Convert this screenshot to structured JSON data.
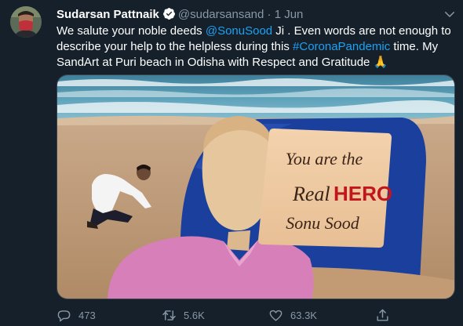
{
  "tweet": {
    "author_name": "Sudarsan Pattnaik",
    "handle": "@sudarsansand",
    "separator": "·",
    "date": "1 Jun",
    "text": {
      "part1": "We salute your noble deeds ",
      "mention": "@SonuSood",
      "part2": " Ji . Even words are not enough to describe your help to the helpless during this ",
      "hashtag": "#CoronaPandemic",
      "part3": " time. My SandArt at Puri beach in Odisha with Respect and Gratitude 🙏"
    },
    "media": {
      "sign_line1": "You are the",
      "sign_line2a": "Real",
      "sign_line2b": "HERO",
      "sign_line3": "Sonu Sood"
    },
    "stats": {
      "replies": "473",
      "retweets": "5.6K",
      "likes": "63.3K"
    }
  },
  "icons": {
    "verified": "verified-badge-icon",
    "more": "chevron-down-icon",
    "reply": "reply-icon",
    "retweet": "retweet-icon",
    "like": "heart-icon",
    "share": "share-icon"
  },
  "colors": {
    "background": "#15202b",
    "link": "#1da1f2",
    "muted": "#8899a6",
    "sign_red": "#c0161c"
  }
}
